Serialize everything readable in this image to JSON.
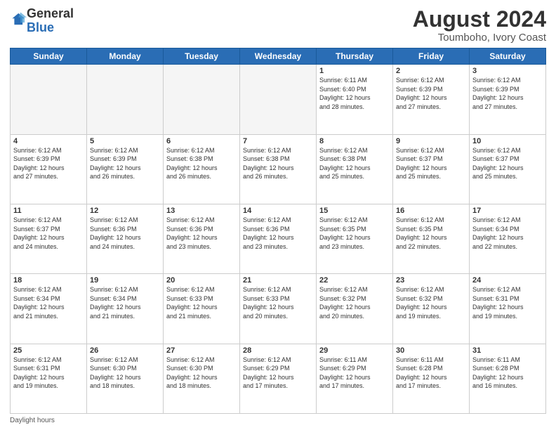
{
  "logo": {
    "general": "General",
    "blue": "Blue"
  },
  "title": "August 2024",
  "subtitle": "Toumboho, Ivory Coast",
  "days_of_week": [
    "Sunday",
    "Monday",
    "Tuesday",
    "Wednesday",
    "Thursday",
    "Friday",
    "Saturday"
  ],
  "footer_note": "Daylight hours",
  "weeks": [
    [
      {
        "day": "",
        "info": ""
      },
      {
        "day": "",
        "info": ""
      },
      {
        "day": "",
        "info": ""
      },
      {
        "day": "",
        "info": ""
      },
      {
        "day": "1",
        "info": "Sunrise: 6:11 AM\nSunset: 6:40 PM\nDaylight: 12 hours\nand 28 minutes."
      },
      {
        "day": "2",
        "info": "Sunrise: 6:12 AM\nSunset: 6:39 PM\nDaylight: 12 hours\nand 27 minutes."
      },
      {
        "day": "3",
        "info": "Sunrise: 6:12 AM\nSunset: 6:39 PM\nDaylight: 12 hours\nand 27 minutes."
      }
    ],
    [
      {
        "day": "4",
        "info": "Sunrise: 6:12 AM\nSunset: 6:39 PM\nDaylight: 12 hours\nand 27 minutes."
      },
      {
        "day": "5",
        "info": "Sunrise: 6:12 AM\nSunset: 6:39 PM\nDaylight: 12 hours\nand 26 minutes."
      },
      {
        "day": "6",
        "info": "Sunrise: 6:12 AM\nSunset: 6:38 PM\nDaylight: 12 hours\nand 26 minutes."
      },
      {
        "day": "7",
        "info": "Sunrise: 6:12 AM\nSunset: 6:38 PM\nDaylight: 12 hours\nand 26 minutes."
      },
      {
        "day": "8",
        "info": "Sunrise: 6:12 AM\nSunset: 6:38 PM\nDaylight: 12 hours\nand 25 minutes."
      },
      {
        "day": "9",
        "info": "Sunrise: 6:12 AM\nSunset: 6:37 PM\nDaylight: 12 hours\nand 25 minutes."
      },
      {
        "day": "10",
        "info": "Sunrise: 6:12 AM\nSunset: 6:37 PM\nDaylight: 12 hours\nand 25 minutes."
      }
    ],
    [
      {
        "day": "11",
        "info": "Sunrise: 6:12 AM\nSunset: 6:37 PM\nDaylight: 12 hours\nand 24 minutes."
      },
      {
        "day": "12",
        "info": "Sunrise: 6:12 AM\nSunset: 6:36 PM\nDaylight: 12 hours\nand 24 minutes."
      },
      {
        "day": "13",
        "info": "Sunrise: 6:12 AM\nSunset: 6:36 PM\nDaylight: 12 hours\nand 23 minutes."
      },
      {
        "day": "14",
        "info": "Sunrise: 6:12 AM\nSunset: 6:36 PM\nDaylight: 12 hours\nand 23 minutes."
      },
      {
        "day": "15",
        "info": "Sunrise: 6:12 AM\nSunset: 6:35 PM\nDaylight: 12 hours\nand 23 minutes."
      },
      {
        "day": "16",
        "info": "Sunrise: 6:12 AM\nSunset: 6:35 PM\nDaylight: 12 hours\nand 22 minutes."
      },
      {
        "day": "17",
        "info": "Sunrise: 6:12 AM\nSunset: 6:34 PM\nDaylight: 12 hours\nand 22 minutes."
      }
    ],
    [
      {
        "day": "18",
        "info": "Sunrise: 6:12 AM\nSunset: 6:34 PM\nDaylight: 12 hours\nand 21 minutes."
      },
      {
        "day": "19",
        "info": "Sunrise: 6:12 AM\nSunset: 6:34 PM\nDaylight: 12 hours\nand 21 minutes."
      },
      {
        "day": "20",
        "info": "Sunrise: 6:12 AM\nSunset: 6:33 PM\nDaylight: 12 hours\nand 21 minutes."
      },
      {
        "day": "21",
        "info": "Sunrise: 6:12 AM\nSunset: 6:33 PM\nDaylight: 12 hours\nand 20 minutes."
      },
      {
        "day": "22",
        "info": "Sunrise: 6:12 AM\nSunset: 6:32 PM\nDaylight: 12 hours\nand 20 minutes."
      },
      {
        "day": "23",
        "info": "Sunrise: 6:12 AM\nSunset: 6:32 PM\nDaylight: 12 hours\nand 19 minutes."
      },
      {
        "day": "24",
        "info": "Sunrise: 6:12 AM\nSunset: 6:31 PM\nDaylight: 12 hours\nand 19 minutes."
      }
    ],
    [
      {
        "day": "25",
        "info": "Sunrise: 6:12 AM\nSunset: 6:31 PM\nDaylight: 12 hours\nand 19 minutes."
      },
      {
        "day": "26",
        "info": "Sunrise: 6:12 AM\nSunset: 6:30 PM\nDaylight: 12 hours\nand 18 minutes."
      },
      {
        "day": "27",
        "info": "Sunrise: 6:12 AM\nSunset: 6:30 PM\nDaylight: 12 hours\nand 18 minutes."
      },
      {
        "day": "28",
        "info": "Sunrise: 6:12 AM\nSunset: 6:29 PM\nDaylight: 12 hours\nand 17 minutes."
      },
      {
        "day": "29",
        "info": "Sunrise: 6:11 AM\nSunset: 6:29 PM\nDaylight: 12 hours\nand 17 minutes."
      },
      {
        "day": "30",
        "info": "Sunrise: 6:11 AM\nSunset: 6:28 PM\nDaylight: 12 hours\nand 17 minutes."
      },
      {
        "day": "31",
        "info": "Sunrise: 6:11 AM\nSunset: 6:28 PM\nDaylight: 12 hours\nand 16 minutes."
      }
    ]
  ]
}
